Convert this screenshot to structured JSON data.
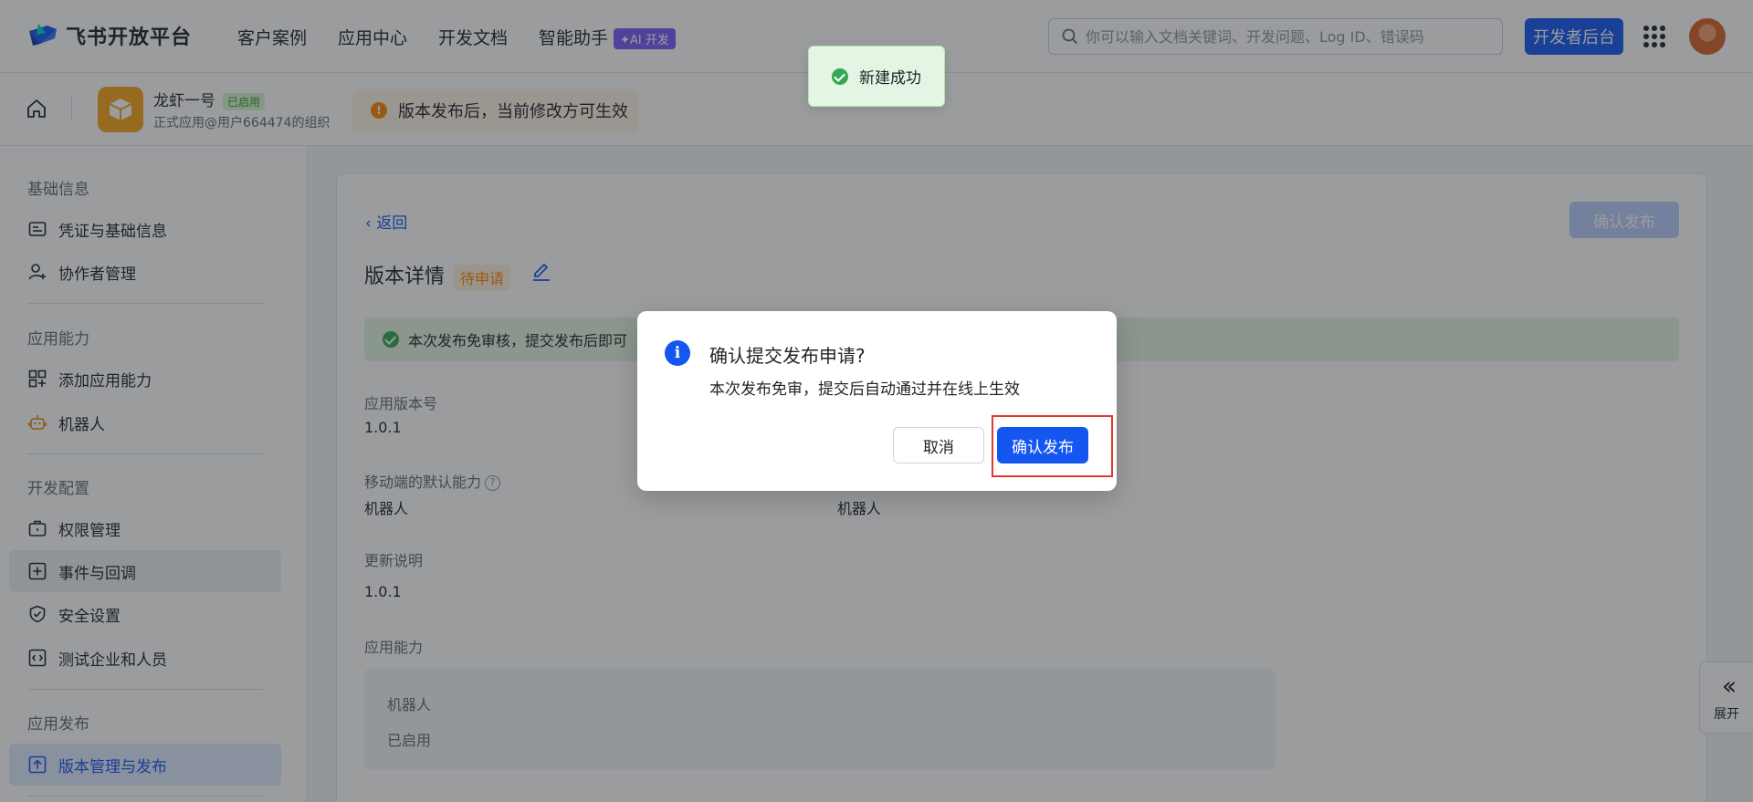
{
  "topnav": {
    "logo_text": "飞书开放平台",
    "links": [
      "客户案例",
      "应用中心",
      "开发文档",
      "智能助手"
    ],
    "ai_badge": "✦AI 开发",
    "search_placeholder": "你可以输入文档关键词、开发问题、Log ID、错误码",
    "dev_console": "开发者后台"
  },
  "app": {
    "name": "龙虾一号",
    "status": "已启用",
    "org": "正式应用@用户664474的组织",
    "notice": "版本发布后，当前修改方可生效"
  },
  "sidebar": {
    "sections": [
      "基础信息",
      "应用能力",
      "开发配置",
      "应用发布"
    ],
    "items": [
      {
        "label": "凭证与基础信息",
        "icon": "id-card-icon"
      },
      {
        "label": "协作者管理",
        "icon": "user-add-icon"
      },
      {
        "label": "添加应用能力",
        "icon": "apps-add-icon"
      },
      {
        "label": "机器人",
        "icon": "robot-icon"
      },
      {
        "label": "权限管理",
        "icon": "briefcase-icon"
      },
      {
        "label": "事件与回调",
        "icon": "event-icon"
      },
      {
        "label": "安全设置",
        "icon": "shield-icon"
      },
      {
        "label": "测试企业和人员",
        "icon": "code-icon"
      },
      {
        "label": "版本管理与发布",
        "icon": "upload-icon"
      }
    ]
  },
  "main": {
    "back": "返回",
    "confirm_publish": "确认发布",
    "title": "版本详情",
    "status": "待申请",
    "banner": "本次发布免审核，提交发布后即可",
    "fields": {
      "version_label": "应用版本号",
      "version_value": "1.0.1",
      "mobile_label": "移动端的默认能力",
      "mobile_value": "机器人",
      "desktop_value": "机器人",
      "notes_label": "更新说明",
      "notes_value": "1.0.1",
      "capability_label": "应用能力",
      "cap_name": "机器人",
      "cap_status": "已启用"
    },
    "expand": "展开"
  },
  "toast": "新建成功",
  "dialog": {
    "title": "确认提交发布申请?",
    "body": "本次发布免审，提交后自动通过并在线上生效",
    "cancel": "取消",
    "confirm": "确认发布"
  },
  "colors": {
    "accent": "#1456f0",
    "success": "#34a853",
    "warning": "#ff8800",
    "highlight": "#e5372f"
  }
}
